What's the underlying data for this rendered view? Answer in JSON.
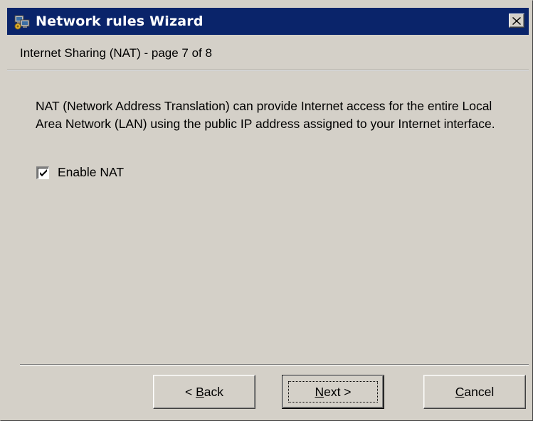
{
  "window": {
    "title": "Network rules Wizard",
    "close_glyph": "✕",
    "icon": "network-wizard-icon"
  },
  "page": {
    "header": "Internet Sharing (NAT) - page 7 of 8",
    "description": "NAT (Network Address Translation) can provide Internet access for the entire Local Area Network (LAN) using the public IP address assigned to your Internet interface."
  },
  "options": {
    "enable_nat": {
      "label": "Enable NAT",
      "checked": true
    }
  },
  "buttons": {
    "back": {
      "prefix": "< ",
      "mnemonic": "B",
      "rest": "ack"
    },
    "next": {
      "mnemonic": "N",
      "rest": "ext >"
    },
    "cancel": {
      "mnemonic": "C",
      "rest": "ancel"
    }
  },
  "colors": {
    "titlebar": "#0a246a",
    "face": "#d4d0c8"
  }
}
